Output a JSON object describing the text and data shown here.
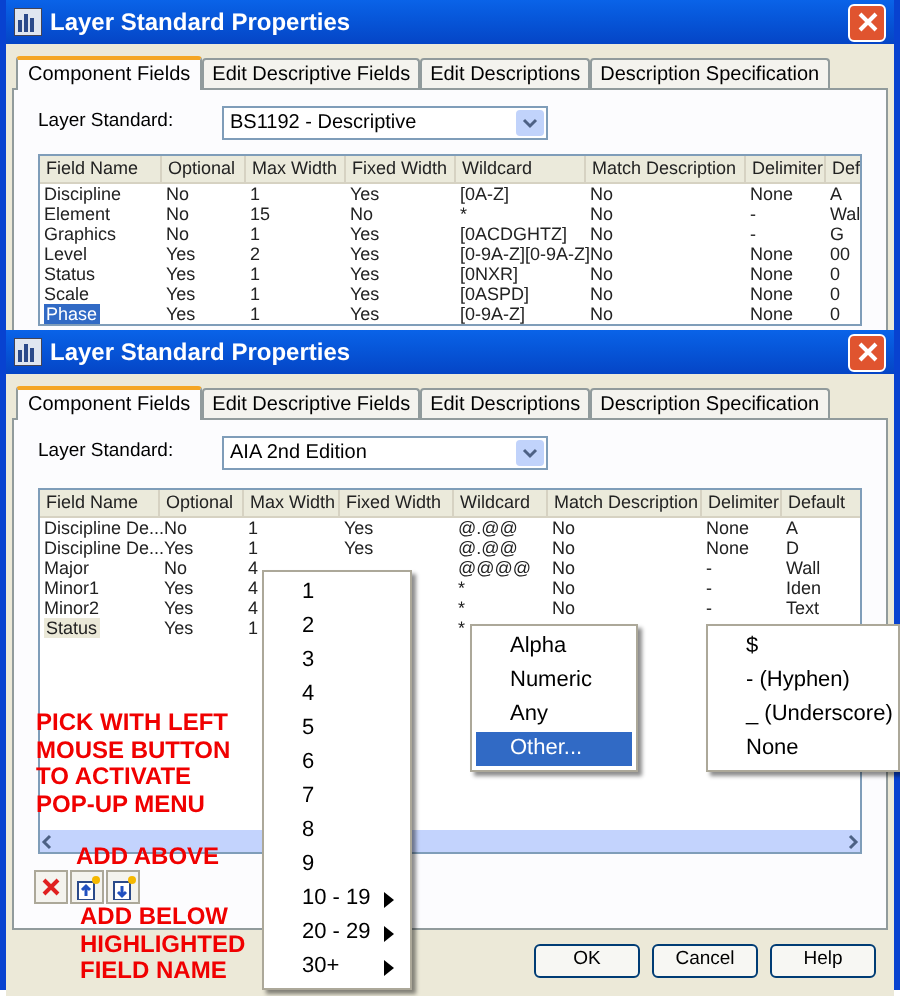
{
  "windows": [
    {
      "title": "Layer Standard Properties",
      "list_focused": true,
      "tabs": [
        {
          "label": "Component Fields",
          "selected": true
        },
        {
          "label": "Edit Descriptive Fields",
          "selected": false
        },
        {
          "label": "Edit Descriptions",
          "selected": false
        },
        {
          "label": "Description Specification",
          "selected": false
        }
      ],
      "layer_standard": {
        "label": "Layer Standard:",
        "value": "BS1192 - Descriptive"
      },
      "table": {
        "columns": [
          "Field Name",
          "Optional",
          "Max Width",
          "Fixed Width",
          "Wildcard",
          "Match Description",
          "Delimiter",
          "Def"
        ],
        "rows": [
          {
            "selected": false,
            "cells": [
              "Discipline",
              "No",
              "1",
              "Yes",
              "[0A-Z]",
              "No",
              "None",
              "A"
            ]
          },
          {
            "selected": false,
            "cells": [
              "Element",
              "No",
              "15",
              "No",
              "*",
              "No",
              "-",
              "Wal"
            ]
          },
          {
            "selected": false,
            "cells": [
              "Graphics",
              "No",
              "1",
              "Yes",
              "[0ACDGHTZ]",
              "No",
              "-",
              "G"
            ]
          },
          {
            "selected": false,
            "cells": [
              "Level",
              "Yes",
              "2",
              "Yes",
              "[0-9A-Z][0-9A-Z]",
              "No",
              "None",
              "00"
            ]
          },
          {
            "selected": false,
            "cells": [
              "Status",
              "Yes",
              "1",
              "Yes",
              "[0NXR]",
              "No",
              "None",
              "0"
            ]
          },
          {
            "selected": false,
            "cells": [
              "Scale",
              "Yes",
              "1",
              "Yes",
              "[0ASPD]",
              "No",
              "None",
              "0"
            ]
          },
          {
            "selected": true,
            "cells": [
              "Phase",
              "Yes",
              "1",
              "Yes",
              "[0-9A-Z]",
              "No",
              "None",
              "0"
            ]
          }
        ]
      }
    },
    {
      "title": "Layer Standard Properties",
      "list_focused": false,
      "tabs": [
        {
          "label": "Component Fields",
          "selected": true
        },
        {
          "label": "Edit Descriptive Fields",
          "selected": false
        },
        {
          "label": "Edit Descriptions",
          "selected": false
        },
        {
          "label": "Description Specification",
          "selected": false
        }
      ],
      "layer_standard": {
        "label": "Layer Standard:",
        "value": "AIA 2nd Edition"
      },
      "table": {
        "columns": [
          "Field Name",
          "Optional",
          "Max Width",
          "Fixed Width",
          "Wildcard",
          "Match Description",
          "Delimiter",
          "Default"
        ],
        "rows": [
          {
            "selected": false,
            "cells": [
              "Discipline De...",
              "No",
              "1",
              "Yes",
              "@.@@",
              "No",
              "None",
              "A"
            ]
          },
          {
            "selected": false,
            "cells": [
              "Discipline De...",
              "Yes",
              "1",
              "Yes",
              "@.@@",
              "No",
              "None",
              "D"
            ]
          },
          {
            "selected": false,
            "cells": [
              "Major",
              "No",
              "4",
              null,
              "@@@@",
              "No",
              "-",
              "Wall"
            ]
          },
          {
            "selected": false,
            "cells": [
              "Minor1",
              "Yes",
              "4",
              null,
              "*",
              "No",
              "-",
              "Iden"
            ]
          },
          {
            "selected": false,
            "cells": [
              "Minor2",
              "Yes",
              "4",
              null,
              "*",
              "No",
              "-",
              "Text"
            ]
          },
          {
            "selected": true,
            "cells": [
              "Status",
              "Yes",
              "1",
              null,
              "*",
              null,
              null,
              null
            ]
          }
        ]
      },
      "buttons": [
        "OK",
        "Cancel",
        "Help"
      ]
    }
  ],
  "popup_menus": [
    {
      "items": [
        {
          "label": "1",
          "submenu": false,
          "selected": false
        },
        {
          "label": "2",
          "submenu": false,
          "selected": false
        },
        {
          "label": "3",
          "submenu": false,
          "selected": false
        },
        {
          "label": "4",
          "submenu": false,
          "selected": false
        },
        {
          "label": "5",
          "submenu": false,
          "selected": false
        },
        {
          "label": "6",
          "submenu": false,
          "selected": false
        },
        {
          "label": "7",
          "submenu": false,
          "selected": false
        },
        {
          "label": "8",
          "submenu": false,
          "selected": false
        },
        {
          "label": "9",
          "submenu": false,
          "selected": false
        },
        {
          "label": "10 - 19",
          "submenu": true,
          "selected": false
        },
        {
          "label": "20 - 29",
          "submenu": true,
          "selected": false
        },
        {
          "label": "30+",
          "submenu": true,
          "selected": false
        }
      ]
    },
    {
      "items": [
        {
          "label": "Alpha",
          "submenu": false,
          "selected": false
        },
        {
          "label": "Numeric",
          "submenu": false,
          "selected": false
        },
        {
          "label": "Any",
          "submenu": false,
          "selected": false
        },
        {
          "label": "Other...",
          "submenu": false,
          "selected": true
        }
      ]
    },
    {
      "items": [
        {
          "label": "$",
          "submenu": false,
          "selected": false
        },
        {
          "label": "- (Hyphen)",
          "submenu": false,
          "selected": false
        },
        {
          "label": "_ (Underscore)",
          "submenu": false,
          "selected": false
        },
        {
          "label": "None",
          "submenu": false,
          "selected": false
        }
      ]
    }
  ],
  "annotations": [
    "PICK WITH LEFT\nMOUSE BUTTON\nTO ACTIVATE\nPOP-UP MENU",
    "ADD ABOVE",
    "ADD BELOW\nHIGHLIGHTED\nFIELD NAME"
  ]
}
